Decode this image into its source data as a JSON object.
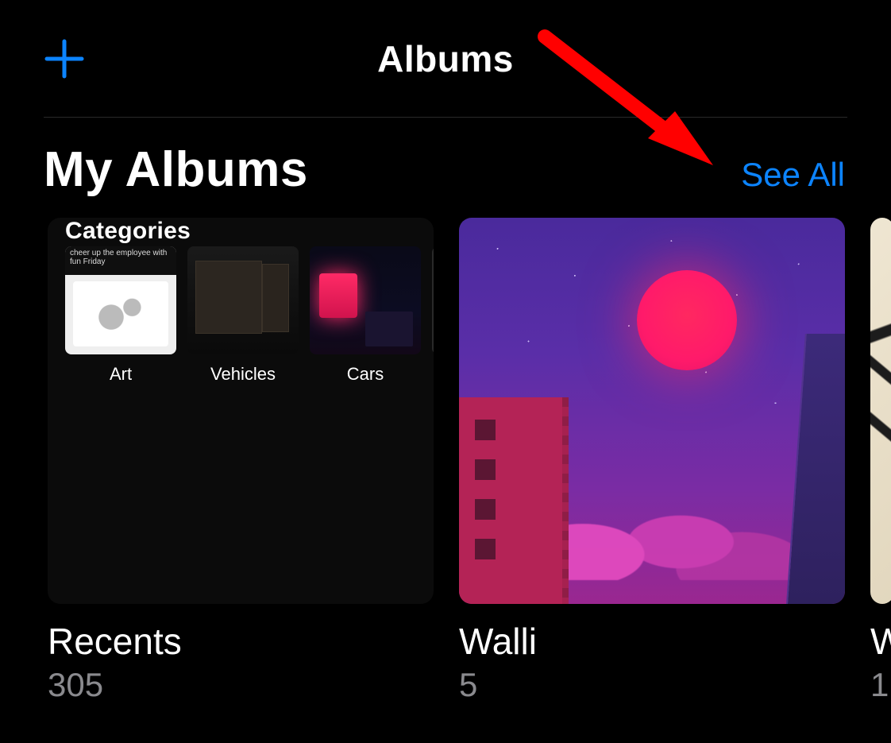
{
  "header": {
    "title": "Albums"
  },
  "section": {
    "title": "My Albums",
    "see_all": "See All"
  },
  "albums": [
    {
      "name": "Recents",
      "count": "305",
      "cover": {
        "heading": "Categories",
        "items": [
          {
            "label": "Art",
            "caption": "cheer up the employee with fun Friday"
          },
          {
            "label": "Vehicles"
          },
          {
            "label": "Cars"
          }
        ]
      }
    },
    {
      "name": "Walli",
      "count": "5"
    },
    {
      "name": "W",
      "count": "1"
    }
  ]
}
